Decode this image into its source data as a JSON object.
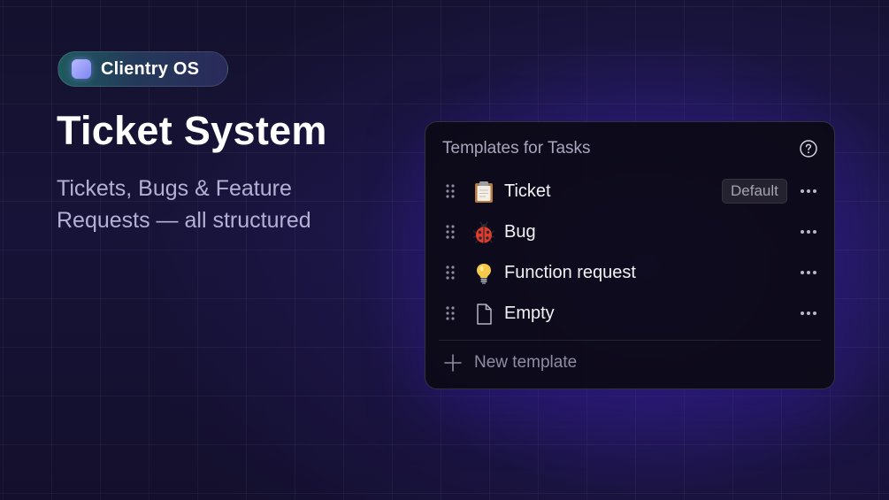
{
  "brand": {
    "name": "Clientry OS",
    "logo_icon": "rounded-square-logo",
    "accent_color": "#8f95ff"
  },
  "hero": {
    "title": "Ticket System",
    "subtitle": "Tickets, Bugs & Feature Requests — all structured"
  },
  "panel": {
    "title": "Templates for Tasks",
    "help_icon": "help-circle-icon",
    "templates": [
      {
        "label": "Ticket",
        "icon": "clipboard-icon",
        "badge": "Default"
      },
      {
        "label": "Bug",
        "icon": "ladybug-icon"
      },
      {
        "label": "Function request",
        "icon": "light-bulb-icon"
      },
      {
        "label": "Empty",
        "icon": "blank-document-icon"
      }
    ],
    "new_template_label": "New template",
    "new_template_icon": "plus-icon"
  },
  "colors": {
    "background": "#14112e",
    "glow": "#6e3cff",
    "panel_bg": "#0c0a16"
  }
}
